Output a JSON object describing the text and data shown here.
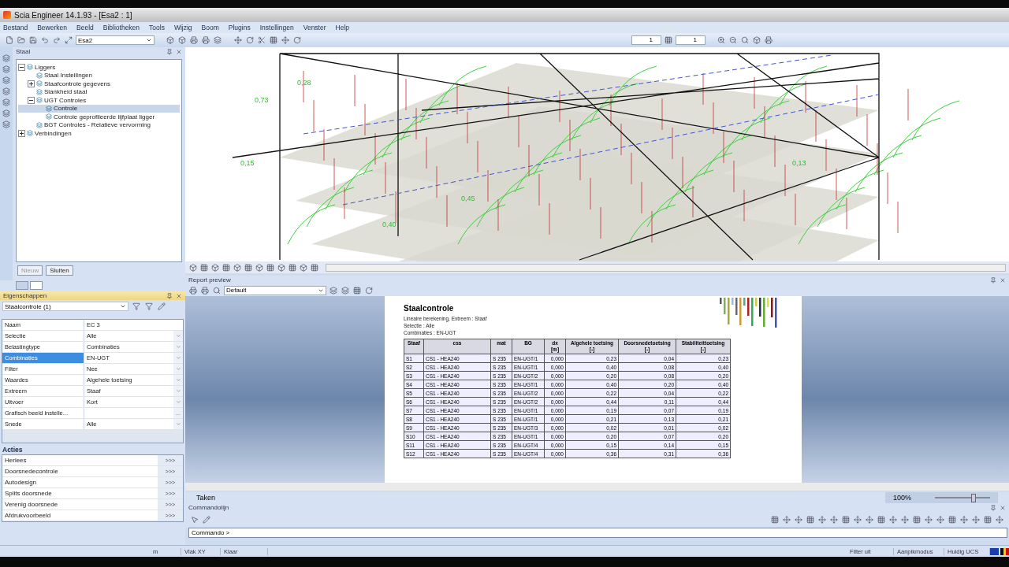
{
  "window": {
    "title": "Scia Engineer 14.1.93 - [Esa2 : 1]"
  },
  "menu": [
    "Bestand",
    "Bewerken",
    "Beeld",
    "Bibliotheken",
    "Tools",
    "Wijzig",
    "Boom",
    "Plugins",
    "Instellingen",
    "Venster",
    "Help"
  ],
  "toolbar": {
    "project": "Esa2",
    "spin_1": "1",
    "spin_2": "1"
  },
  "tree_panel": {
    "title": "Staal",
    "items": [
      {
        "label": "Liggers",
        "expanded": true,
        "selected": false,
        "children": [
          {
            "label": "Staal Instellingen",
            "selected": false
          },
          {
            "label": "Staafcontrole gegevens",
            "expanded": false,
            "selected": false
          },
          {
            "label": "Slankheid staal",
            "selected": false
          },
          {
            "label": "UGT Controles",
            "expanded": true,
            "selected": false,
            "children": [
              {
                "label": "Controle",
                "selected": true
              },
              {
                "label": "Controle geprofileerde lijfplaat ligger",
                "selected": false
              }
            ]
          },
          {
            "label": "BGT Controles - Relatieve vervorming",
            "selected": false
          }
        ]
      },
      {
        "label": "Verbindingen",
        "expanded": false,
        "selected": false
      }
    ],
    "buttons": [
      {
        "label": "Nieuw",
        "disabled": true
      },
      {
        "label": "Sluiten",
        "disabled": false
      }
    ]
  },
  "properties": {
    "title": "Eigenschappen",
    "object": "Staalcontrole (1)",
    "rows": [
      {
        "label": "Naam",
        "value": "EC 3",
        "kind": "text",
        "selected": false
      },
      {
        "label": "Selectie",
        "value": "Alle",
        "kind": "combo",
        "selected": false
      },
      {
        "label": "Belastingtype",
        "value": "Combinaties",
        "kind": "combo",
        "selected": false
      },
      {
        "label": "Combinaties",
        "value": "EN-UGT",
        "kind": "combo",
        "selected": true
      },
      {
        "label": "Filter",
        "value": "Nee",
        "kind": "combo",
        "selected": false
      },
      {
        "label": "Waardes",
        "value": "Algehele toetsing",
        "kind": "combo",
        "selected": false
      },
      {
        "label": "Extreem",
        "value": "Staaf",
        "kind": "combo",
        "selected": false
      },
      {
        "label": "Uitvoer",
        "value": "Kort",
        "kind": "combo",
        "selected": false
      },
      {
        "label": "Grafisch beeld instelle...",
        "button": "...",
        "kind": "button",
        "selected": false
      },
      {
        "label": "Snede",
        "value": "Alle",
        "kind": "combo",
        "selected": false
      }
    ]
  },
  "actions": {
    "title": "Acties",
    "items": [
      {
        "label": "Herlees",
        "button": ">>>"
      },
      {
        "label": "Doorsnedecontrole",
        "button": ">>>"
      },
      {
        "label": "Autodesign",
        "button": ">>>"
      },
      {
        "label": "Splits doorsnede",
        "button": ">>>"
      },
      {
        "label": "Verenig doorsnede",
        "button": ">>>"
      },
      {
        "label": "Afdrukvoorbeeld",
        "button": ">>>"
      }
    ]
  },
  "view": {
    "labels": [
      "0,73",
      "0,28",
      "0,15",
      "0,40",
      "0,13",
      "0,45"
    ]
  },
  "report_preview": {
    "title": "Report preview",
    "template": "Default",
    "heading": "Staalcontrole",
    "lines": [
      "Lineaire berekening,  Extreem : Staaf",
      "Selectie : Alle",
      "Combinaties : EN-UGT"
    ],
    "columns": [
      {
        "label": "Staaf"
      },
      {
        "label": "css"
      },
      {
        "label": "mat"
      },
      {
        "label": "BG"
      },
      {
        "label": "dx",
        "unit": "[m]"
      },
      {
        "label": "Algehele  toetsing",
        "unit": "[-]"
      },
      {
        "label": "Doorsnedetoetsing",
        "unit": "[-]"
      },
      {
        "label": "Stabiliteittoetsing",
        "unit": "[-]"
      }
    ],
    "rows": [
      [
        "S1",
        "CS1 - HEA240",
        "S 235",
        "EN-UGT/1",
        "0,000",
        "0,23",
        "0,04",
        "0,23"
      ],
      [
        "S2",
        "CS1 - HEA240",
        "S 235",
        "EN-UGT/1",
        "0,000",
        "0,40",
        "0,08",
        "0,40"
      ],
      [
        "S3",
        "CS1 - HEA240",
        "S 235",
        "EN-UGT/2",
        "0,000",
        "0,20",
        "0,08",
        "0,20"
      ],
      [
        "S4",
        "CS1 - HEA240",
        "S 235",
        "EN-UGT/1",
        "0,000",
        "0,40",
        "0,20",
        "0,40"
      ],
      [
        "S5",
        "CS1 - HEA240",
        "S 235",
        "EN-UGT/2",
        "0,000",
        "0,22",
        "0,04",
        "0,22"
      ],
      [
        "S6",
        "CS1 - HEA240",
        "S 235",
        "EN-UGT/2",
        "0,000",
        "0,44",
        "0,11",
        "0,44"
      ],
      [
        "S7",
        "CS1 - HEA240",
        "S 235",
        "EN-UGT/1",
        "0,000",
        "0,19",
        "0,07",
        "0,19"
      ],
      [
        "S8",
        "CS1 - HEA240",
        "S 235",
        "EN-UGT/1",
        "0,000",
        "0,21",
        "0,13",
        "0,21"
      ],
      [
        "S9",
        "CS1 - HEA240",
        "S 235",
        "EN-UGT/3",
        "0,000",
        "0,02",
        "0,01",
        "0,02"
      ],
      [
        "S10",
        "CS1 - HEA240",
        "S 235",
        "EN-UGT/1",
        "0,000",
        "0,20",
        "0,07",
        "0,20"
      ],
      [
        "S11",
        "CS1 - HEA240",
        "S 235",
        "EN-UGT/4",
        "0,000",
        "0,15",
        "0,14",
        "0,15"
      ],
      [
        "S12",
        "CS1 - HEA240",
        "S 235",
        "EN-UGT/4",
        "0,000",
        "0,36",
        "0,31",
        "0,36"
      ]
    ]
  },
  "tasks": {
    "title": "Taken",
    "zoom": "100%",
    "level": 0.7
  },
  "command": {
    "title": "Commandolijn",
    "prompt": "Commando >"
  },
  "status_bar": [
    "m",
    "Vlak XY",
    "Klaar",
    "Filter uit",
    "Aanpikmodus",
    "Huidig UCS"
  ]
}
